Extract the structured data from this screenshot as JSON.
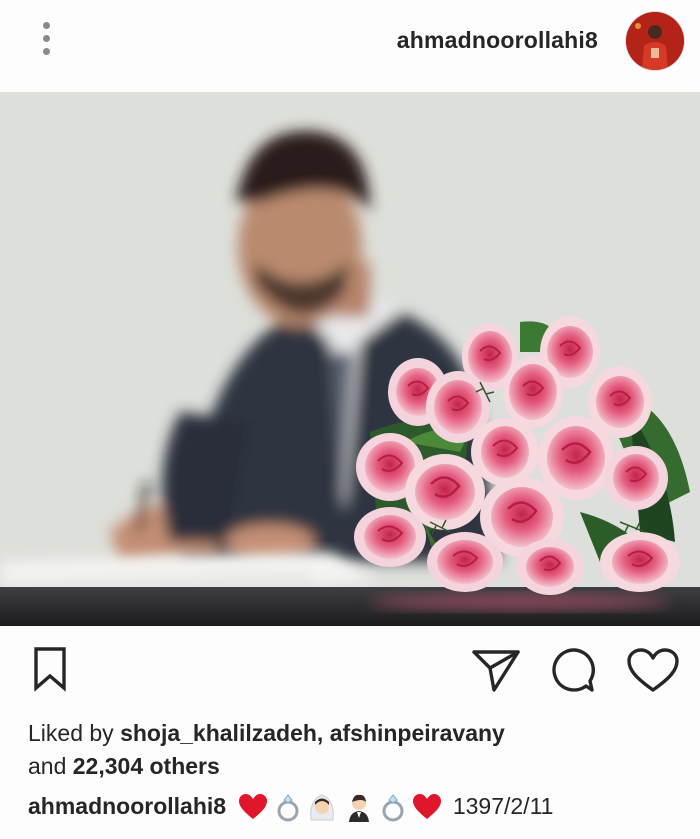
{
  "header": {
    "username": "ahmadnoorollahi8",
    "more_icon": "more-vertical-icon",
    "avatar_icon": "profile-avatar"
  },
  "post": {
    "image_alt": "man signing documents with pink rose bouquet",
    "actions": {
      "bookmark_icon": "bookmark-icon",
      "share_icon": "send-icon",
      "comment_icon": "comment-icon",
      "like_icon": "heart-icon"
    },
    "likes": {
      "prefix": "Liked by",
      "user1": "shoja_khalilzadeh,",
      "user2": "afshinpeiravany",
      "and": "and",
      "others": "22,304 others"
    },
    "caption": {
      "username": "ahmadnoorollahi8",
      "emojis": [
        "red-heart",
        "ring",
        "bride-with-veil",
        "man-in-tuxedo",
        "ring",
        "red-heart"
      ],
      "date": "1397/2/11"
    }
  },
  "colors": {
    "heart_red": "#e0162b",
    "icon_dark": "#262626",
    "rose_pink": "#e8587a"
  }
}
